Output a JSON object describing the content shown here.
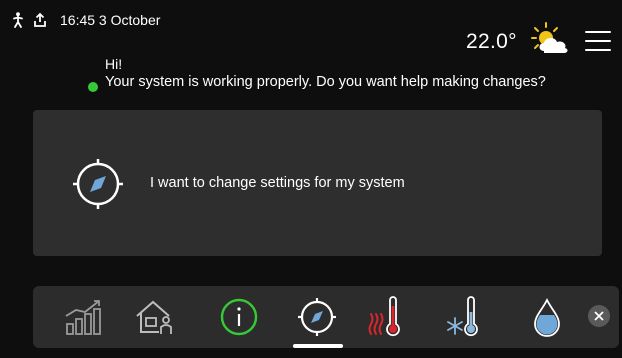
{
  "status_bar": {
    "icons": [
      "person-icon",
      "upload-icon"
    ],
    "datetime": "16:45 3 October"
  },
  "header": {
    "temperature": "22.0°",
    "weather_icon": "partly-cloudy-sun-icon",
    "menu_icon": "hamburger-menu-icon"
  },
  "greeting": {
    "hi": "Hi!",
    "message": "Your system is working properly. Do you want help making changes?",
    "status_color": "#37c837"
  },
  "card": {
    "icon": "compass-icon",
    "label": "I want to change settings for my system"
  },
  "bottom_bar": {
    "items": [
      {
        "name": "energy-statistics",
        "icon": "bar-chart-icon"
      },
      {
        "name": "home-profile",
        "icon": "house-person-icon"
      },
      {
        "name": "info",
        "icon": "info-icon",
        "color": "#37c837"
      },
      {
        "name": "settings-guide",
        "icon": "compass-icon",
        "active": true
      },
      {
        "name": "heating",
        "icon": "thermometer-heat-icon",
        "color": "#d9262b"
      },
      {
        "name": "cooling",
        "icon": "thermometer-snow-icon"
      },
      {
        "name": "hot-water",
        "icon": "water-drop-icon",
        "color": "#6fa8d8"
      }
    ],
    "close_icon": "close-icon"
  },
  "colors": {
    "background": "#0e0e0e",
    "card": "#2e2e2e",
    "bar": "#2c2c2c",
    "accent_green": "#37c837",
    "heat_red": "#d9262b",
    "water_blue": "#6fa8d8"
  }
}
